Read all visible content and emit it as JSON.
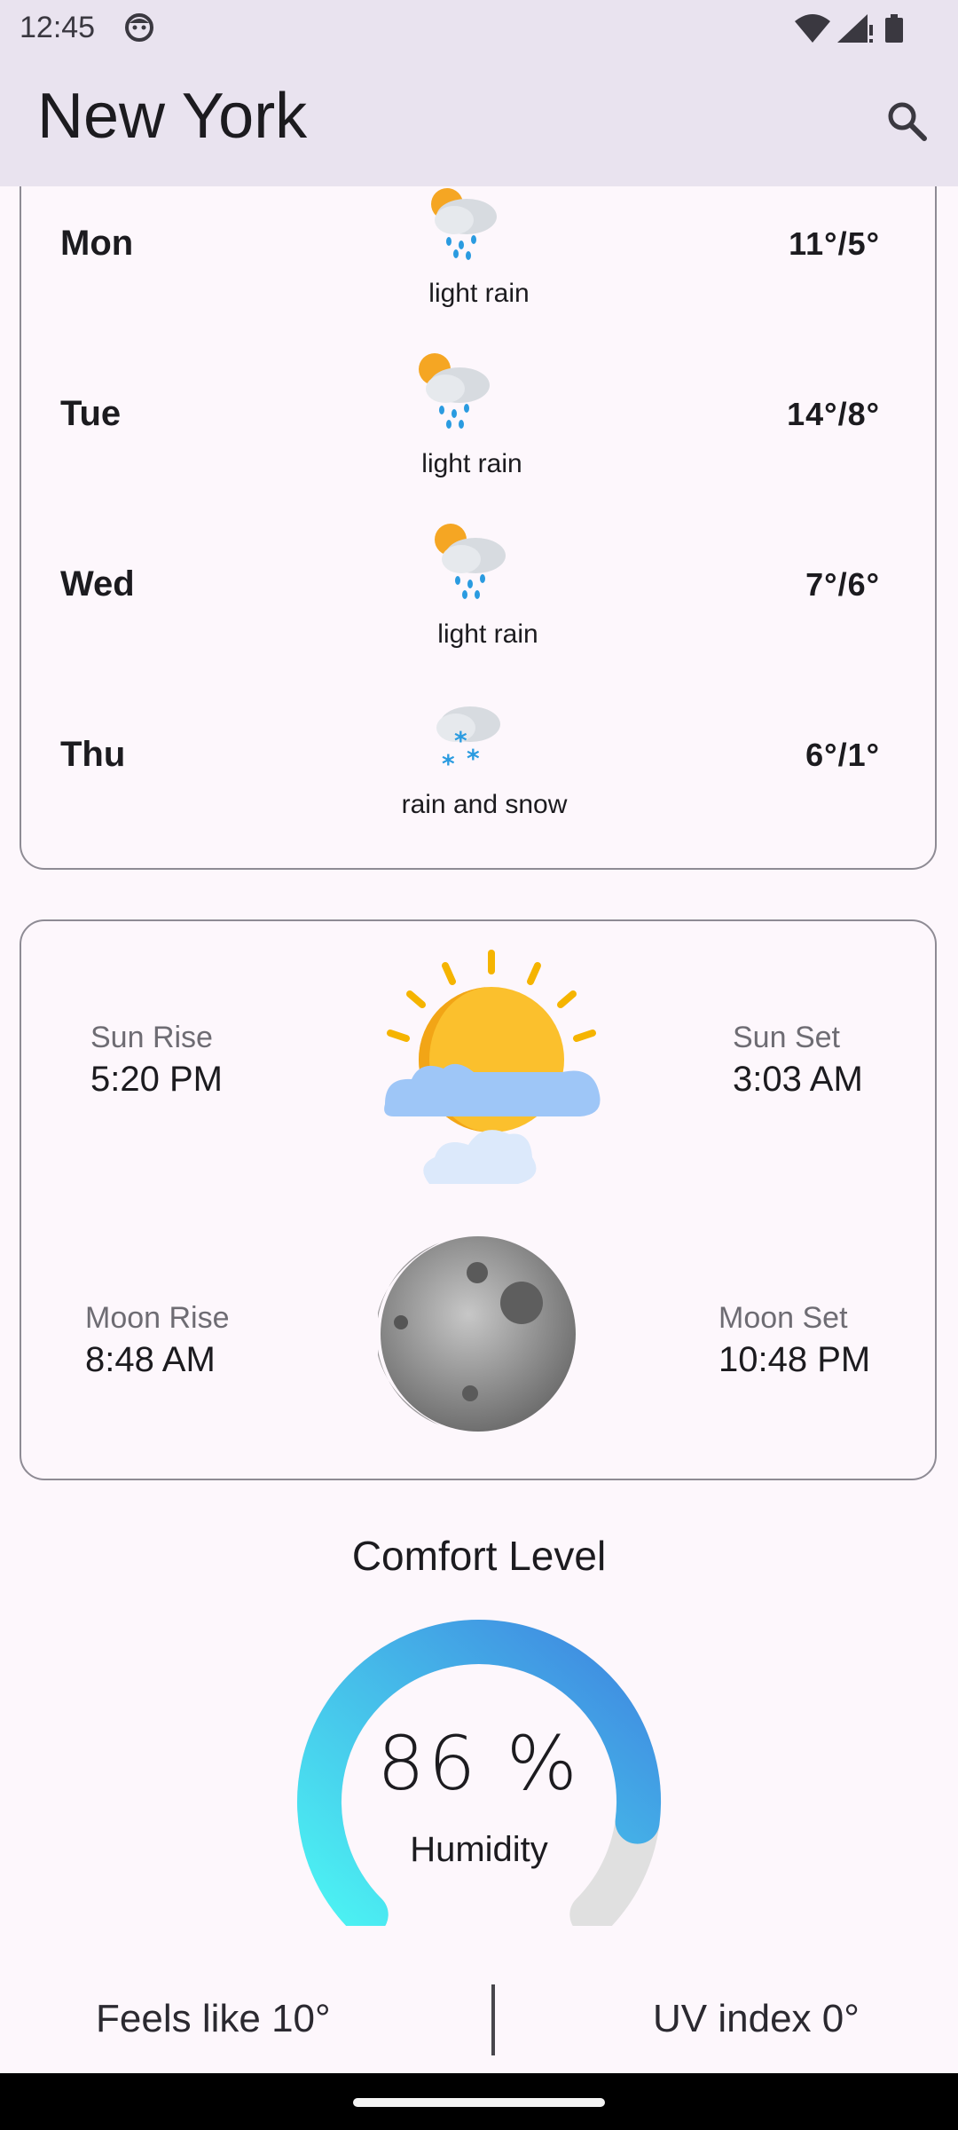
{
  "status": {
    "time": "12:45"
  },
  "app": {
    "title": "New York"
  },
  "forecast": [
    {
      "day": "Mon",
      "desc": "light rain",
      "temp": "11°/5°",
      "icon": "rain-sun-icon"
    },
    {
      "day": "Tue",
      "desc": "light rain",
      "temp": "14°/8°",
      "icon": "rain-sun-icon"
    },
    {
      "day": "Wed",
      "desc": "light rain",
      "temp": "7°/6°",
      "icon": "rain-sun-icon"
    },
    {
      "day": "Thu",
      "desc": "rain and snow",
      "temp": "6°/1°",
      "icon": "snow-cloud-icon"
    }
  ],
  "astro": {
    "sun_rise_label": "Sun Rise",
    "sun_rise": "5:20 PM",
    "sun_set_label": "Sun Set",
    "sun_set": "3:03 AM",
    "moon_rise_label": "Moon Rise",
    "moon_rise": "8:48 AM",
    "moon_set_label": "Moon Set",
    "moon_set": "10:48 PM"
  },
  "comfort": {
    "title": "Comfort Level",
    "value": "86 %",
    "label": "Humidity",
    "humidity_fraction": 0.86
  },
  "bottom": {
    "feels_like": "Feels like 10°",
    "uv_index": "UV index 0°"
  },
  "colors": {
    "appbar": "#e9e3ef",
    "background": "#fdf7fc",
    "gauge_start": "#4cf3f3",
    "gauge_end": "#3f86e0",
    "gauge_track": "#e0e0e0"
  }
}
